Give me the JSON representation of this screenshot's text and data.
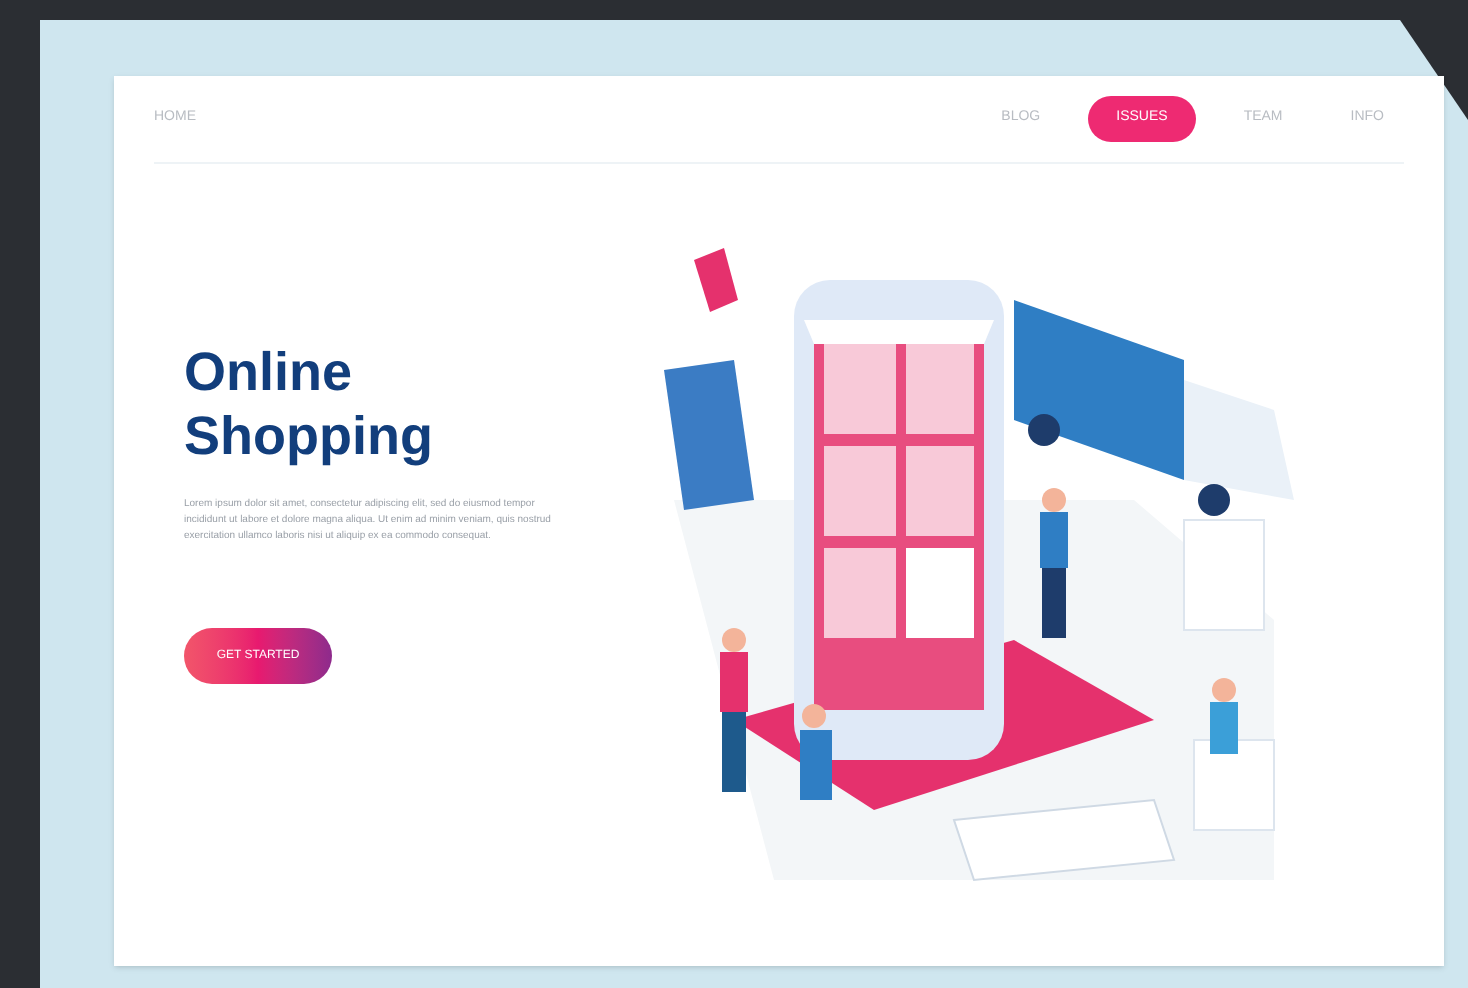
{
  "nav": {
    "home": "HOME",
    "links": [
      {
        "label": "BLOG",
        "selected": false
      },
      {
        "label": "ISSUES",
        "selected": true
      },
      {
        "label": "TEAM",
        "selected": false
      },
      {
        "label": "INFO",
        "selected": false
      }
    ]
  },
  "hero": {
    "title": "Online Shopping",
    "body": "Lorem ipsum dolor sit amet, consectetur adipiscing elit, sed do eiusmod tempor incididunt ut labore et dolore magna aliqua. Ut enim ad minim veniam, quis nostrud exercitation ullamco laboris nisi ut aliquip ex ea commodo consequat.",
    "button": "GET STARTED"
  }
}
